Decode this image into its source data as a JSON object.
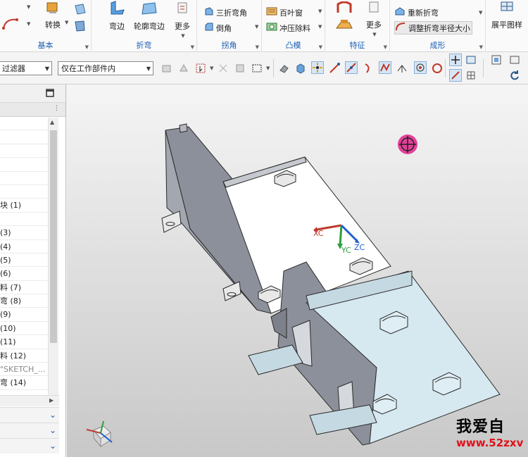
{
  "ribbon": {
    "groups": [
      {
        "label": "基本",
        "buttons": [
          "转换"
        ]
      },
      {
        "label": "折弯",
        "buttons": [
          "弯边",
          "轮廓弯边",
          "更多"
        ]
      },
      {
        "label": "拐角",
        "buttons": [
          "三折弯角",
          "倒角"
        ]
      },
      {
        "label": "凸模",
        "buttons": [
          "百叶窗",
          "冲压除料"
        ]
      },
      {
        "label": "特征",
        "buttons": [
          "更多"
        ]
      },
      {
        "label": "成形",
        "buttons": [
          "重新折弯",
          "调整折弯半径大小"
        ]
      },
      {
        "label": "",
        "buttons": [
          "展平图样"
        ]
      }
    ]
  },
  "selection_bar": {
    "type_filter": "过滤器",
    "scope_filter": "仅在工作部件内"
  },
  "navigator": {
    "rows": [
      "",
      "",
      "",
      "",
      "",
      "",
      "块 (1)",
      "",
      "(3)",
      "(4)",
      "(5)",
      "(6)",
      "料 (7)",
      "弯 (8)",
      "(9)",
      "(10)",
      "(11)",
      "料 (12)",
      "\"SKETCH_...",
      "弯 (14)"
    ]
  },
  "viewport": {
    "axes": {
      "x": "XC",
      "y": "YC",
      "z": "ZC"
    }
  },
  "watermark": {
    "line1": "我爱自",
    "line2": "www.52zxv"
  },
  "colors": {
    "accent_blue": "#1a5fb4",
    "part_gray": "#8c909a",
    "part_light_blue": "#d6e8f0",
    "cursor_magenta": "#e0218a"
  }
}
